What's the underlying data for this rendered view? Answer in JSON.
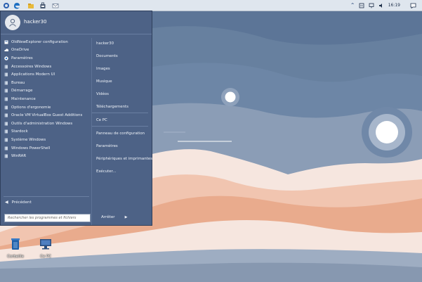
{
  "taskbar": {
    "icons": [
      "start-icon",
      "edge-icon",
      "store-icon",
      "bag-icon",
      "mail-icon"
    ],
    "tray": {
      "chevron": "^",
      "clock": "16:19"
    }
  },
  "start_menu": {
    "user": "hacker30",
    "programs": [
      {
        "label": "OldNewExplorer configuration",
        "icon": "app-icon"
      },
      {
        "label": "OneDrive",
        "icon": "cloud-icon"
      },
      {
        "label": "Paramètres",
        "icon": "gear-icon"
      },
      {
        "label": "Accessoires Windows",
        "icon": "folder-icon"
      },
      {
        "label": "Applications Modern UI",
        "icon": "folder-icon"
      },
      {
        "label": "Bureau",
        "icon": "folder-icon"
      },
      {
        "label": "Démarrage",
        "icon": "folder-icon"
      },
      {
        "label": "Maintenance",
        "icon": "folder-icon"
      },
      {
        "label": "Options d'ergonomie",
        "icon": "folder-icon"
      },
      {
        "label": "Oracle VM VirtualBox Guest Additions",
        "icon": "folder-icon"
      },
      {
        "label": "Outils d'administration Windows",
        "icon": "folder-icon"
      },
      {
        "label": "Stardock",
        "icon": "folder-icon"
      },
      {
        "label": "Système Windows",
        "icon": "folder-icon"
      },
      {
        "label": "Windows PowerShell",
        "icon": "folder-icon"
      },
      {
        "label": "WinRAR",
        "icon": "folder-icon"
      }
    ],
    "right_items": {
      "user": "hacker30",
      "documents": "Documents",
      "images": "Images",
      "music": "Musique",
      "videos": "Vidéos",
      "downloads": "Téléchargements",
      "this_pc": "Ce PC",
      "control_panel": "Panneau de configuration",
      "settings": "Paramètres",
      "devices": "Périphériques et imprimantes",
      "run": "Exécuter..."
    },
    "back_label": "Précédent",
    "search_placeholder": "Rechercher les programmes et fichiers",
    "shutdown_label": "Arrêter"
  },
  "desktop": {
    "icons": [
      {
        "label": "Corbeille",
        "icon": "recycle-bin-icon"
      },
      {
        "label": "Ce PC",
        "icon": "computer-icon"
      }
    ]
  },
  "colors": {
    "menu_bg": "#4d6286",
    "sky": "#5c7597",
    "taskbar": "#dfe6ee"
  }
}
